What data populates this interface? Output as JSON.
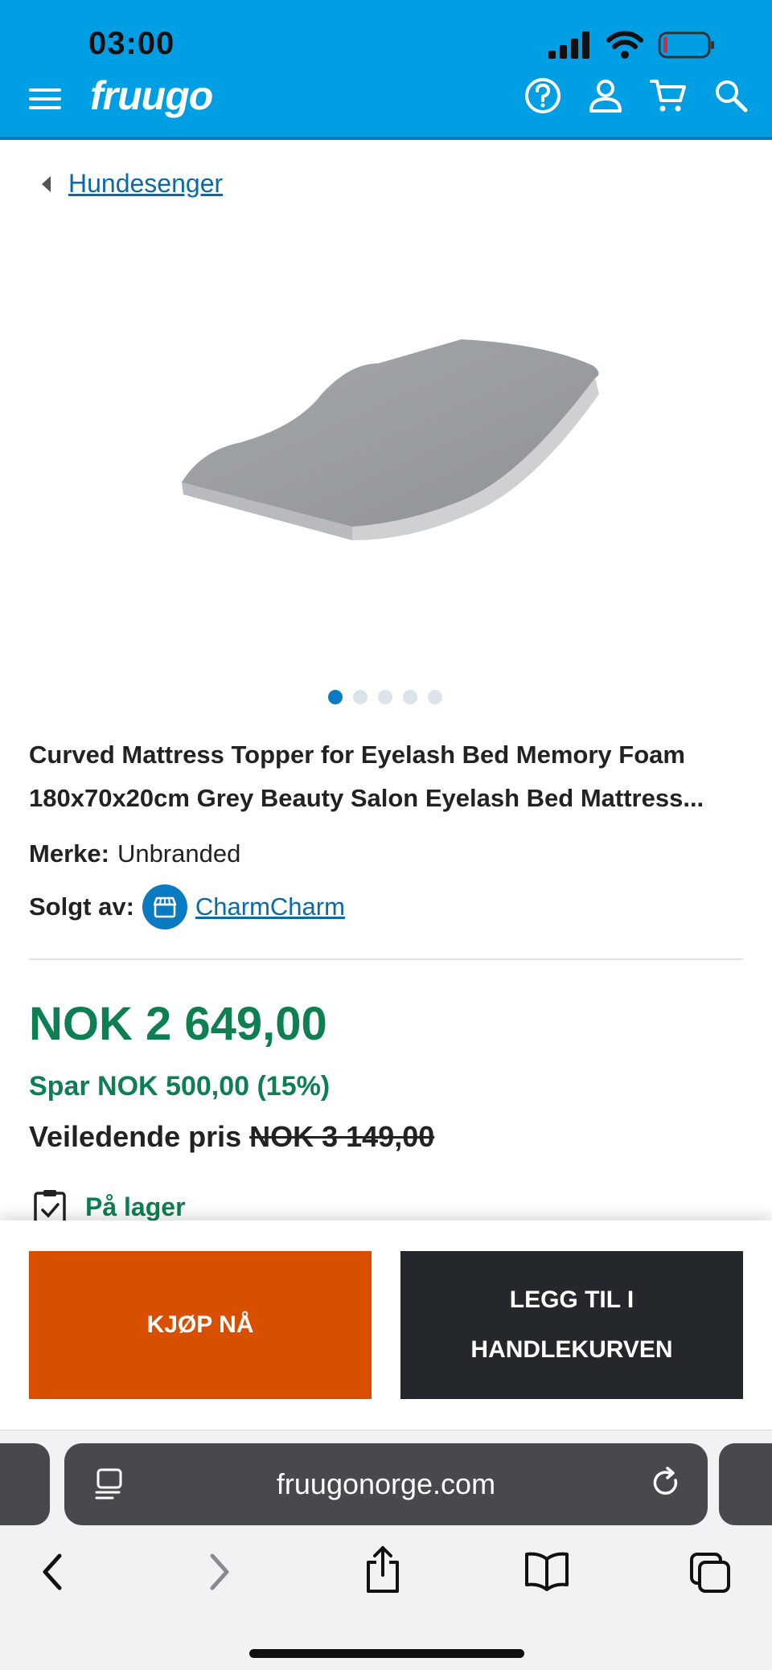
{
  "status_bar": {
    "time": "03:00"
  },
  "header": {
    "logo": "fruugo"
  },
  "breadcrumb": {
    "label": "Hundesenger"
  },
  "gallery": {
    "dot_count": 5,
    "active_index": 0
  },
  "product": {
    "title": "Curved Mattress Topper for Eyelash Bed Memory Foam 180x70x20cm Grey Beauty Salon Eyelash Bed Mattress...",
    "brand_label": "Merke:",
    "brand_value": "Unbranded",
    "seller_label": "Solgt av:",
    "seller_name": "CharmCharm"
  },
  "pricing": {
    "price": "NOK 2 649,00",
    "save": "Spar NOK 500,00 (15%)",
    "rrp_label": "Veiledende pris",
    "rrp_value": "NOK 3 149,00"
  },
  "stock": {
    "label": "På lager"
  },
  "actions": {
    "buy_now": "KJØP NÅ",
    "add_to_cart_line1": "LEGG TIL I",
    "add_to_cart_line2": "HANDLEKURVEN"
  },
  "browser": {
    "url": "fruugonorge.com"
  },
  "colors": {
    "brand_blue": "#009ee3",
    "price_green": "#0d7f53",
    "buy_orange": "#d94f00",
    "cart_dark": "#24272b"
  }
}
